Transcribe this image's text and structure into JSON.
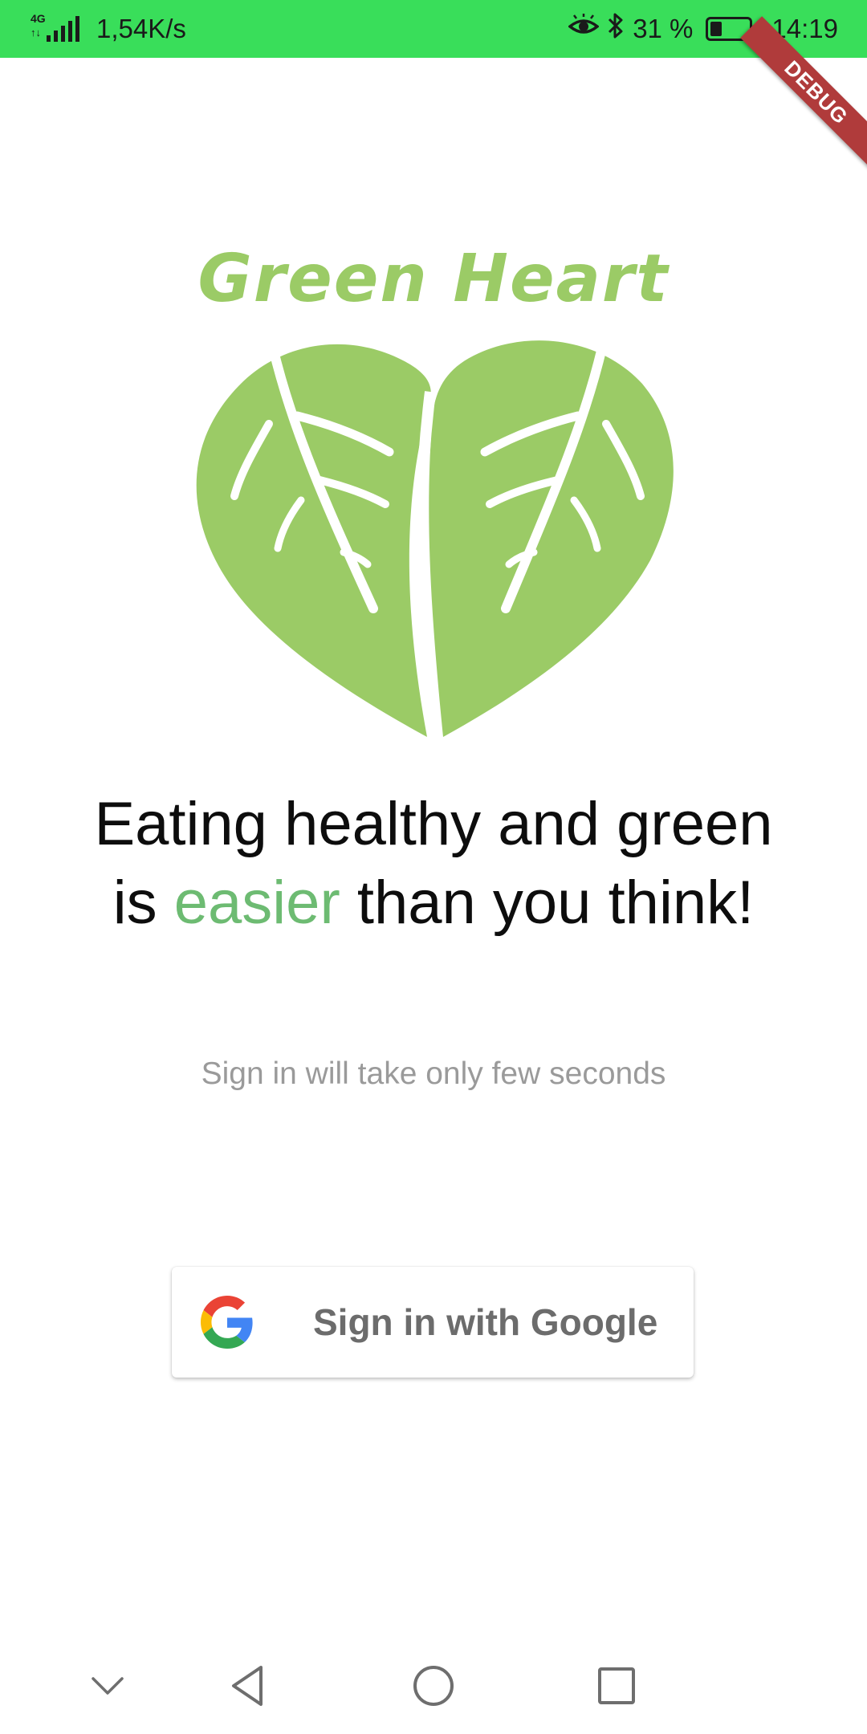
{
  "status_bar": {
    "network_type": "4G",
    "data_arrows": "↑↓",
    "speed": "1,54K/s",
    "battery_percent": "31 %",
    "battery_level": 0.31,
    "time": "14:19",
    "icons": [
      "signal-icon",
      "eye-icon",
      "bluetooth-icon",
      "battery-icon"
    ],
    "background_color": "#39de5a"
  },
  "debug_banner": {
    "label": "DEBUG",
    "color": "#b03b3b"
  },
  "logo": {
    "brand_name": "Green Heart",
    "icon": "leaf-heart-icon",
    "color": "#9bcb66"
  },
  "headline": {
    "part1": "Eating healthy and green is ",
    "accent": "easier",
    "part2": " than you think!",
    "accent_color": "#6dbb72"
  },
  "subtitle": "Sign in will take only few seconds",
  "google_button": {
    "label": "Sign in with Google",
    "icon": "google-g-icon"
  },
  "nav_bar": {
    "buttons": [
      "chevron-down-icon",
      "back-icon",
      "home-icon",
      "recents-icon"
    ]
  }
}
